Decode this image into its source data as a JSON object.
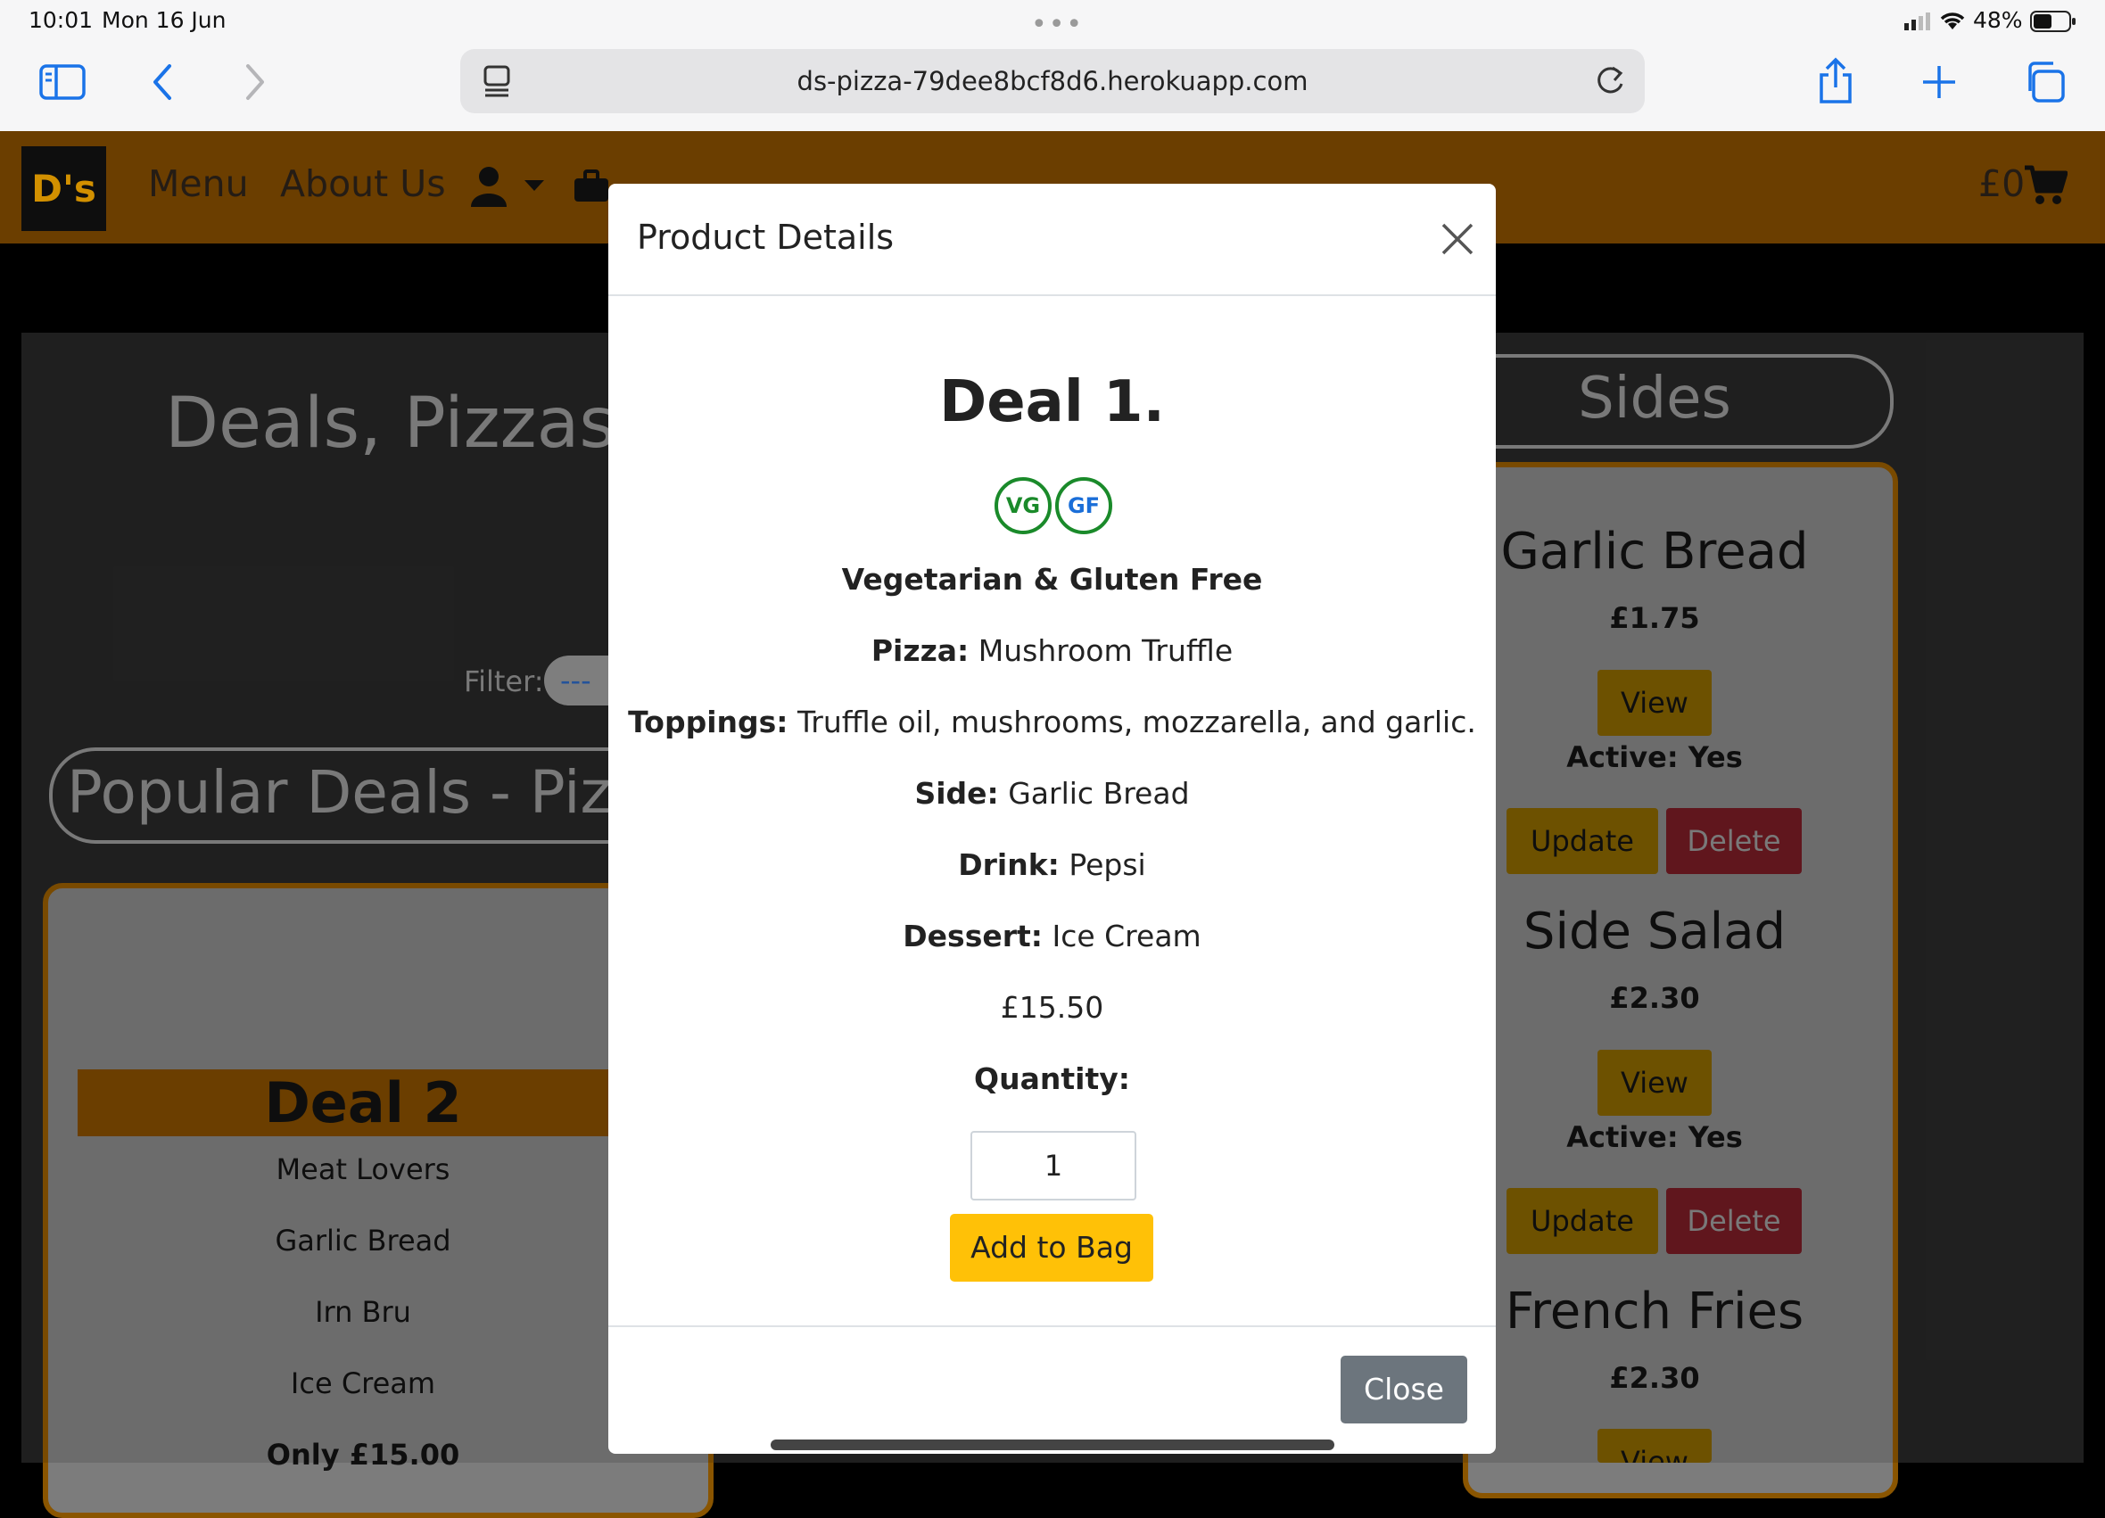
{
  "status_bar": {
    "time": "10:01",
    "date": "Mon 16 Jun",
    "battery": "48%"
  },
  "browser": {
    "url": "ds-pizza-79dee8bcf8d6.herokuapp.com"
  },
  "navbar": {
    "logo": "D's",
    "menu": "Menu",
    "about": "About Us",
    "cart_total": "£0"
  },
  "page": {
    "title": "Deals, Pizzas",
    "filter_label": "Filter:",
    "filter_value": "---",
    "section_title": "Popular Deals - Piz",
    "sides_title": "Sides"
  },
  "deal_card": {
    "title": "Deal 2",
    "items": [
      "Meat Lovers",
      "Garlic Bread",
      "Irn Bru",
      "Ice Cream"
    ],
    "price": "Only £15.00"
  },
  "sides": [
    {
      "name": "Garlic Bread",
      "price": "£1.75",
      "view": "View",
      "active": "Active: Yes",
      "update": "Update",
      "delete": "Delete"
    },
    {
      "name": "Side Salad",
      "price": "£2.30",
      "view": "View",
      "active": "Active: Yes",
      "update": "Update",
      "delete": "Delete"
    },
    {
      "name": "French Fries",
      "price": "£2.30",
      "view": "View"
    }
  ],
  "modal": {
    "header": "Product Details",
    "deal_title": "Deal 1.",
    "badges": [
      "VG",
      "GF"
    ],
    "diet": "Vegetarian & Gluten Free",
    "pizza_label": "Pizza:",
    "pizza": "Mushroom Truffle",
    "toppings_label": "Toppings:",
    "toppings": "Truffle oil, mushrooms, mozzarella, and garlic.",
    "side_label": "Side:",
    "side": "Garlic Bread",
    "drink_label": "Drink:",
    "drink": "Pepsi",
    "dessert_label": "Dessert:",
    "dessert": "Ice Cream",
    "price": "£15.50",
    "quantity_label": "Quantity:",
    "quantity": "1",
    "add_button": "Add to Bag",
    "close_button": "Close"
  },
  "colors": {
    "brand": "#7a4700",
    "accent": "#ffc107",
    "vg": "#1a8a2a",
    "gf": "#1a6ed8"
  }
}
